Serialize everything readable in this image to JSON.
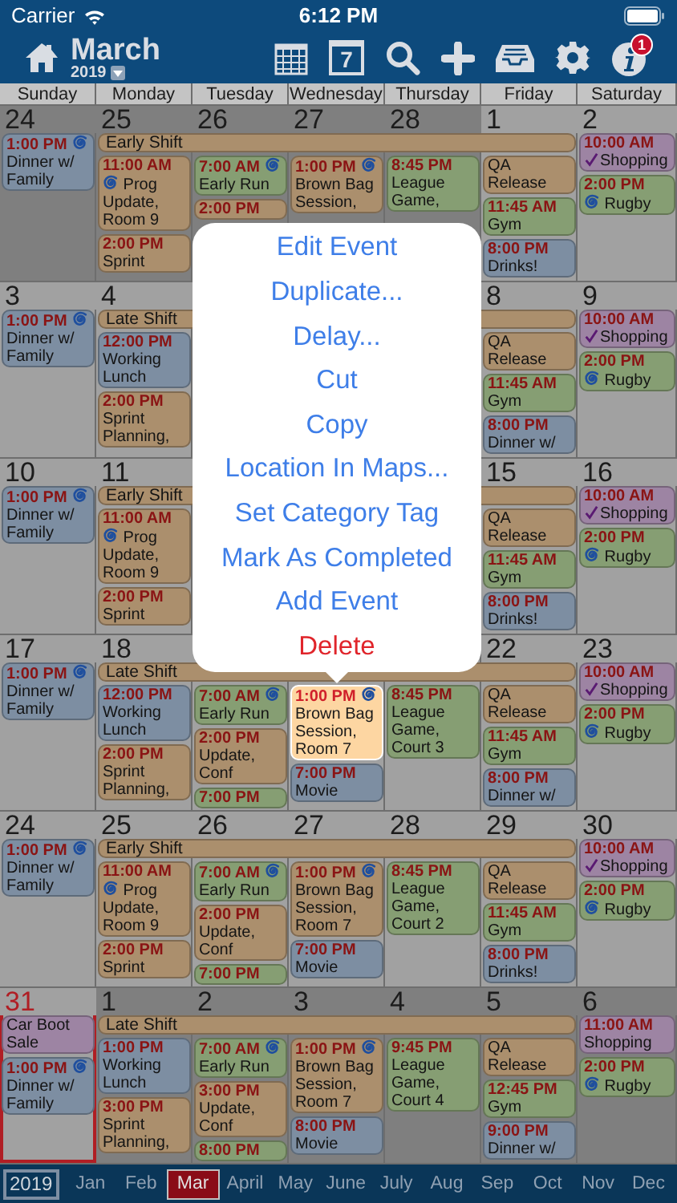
{
  "status_bar": {
    "carrier": "Carrier",
    "time": "6:12 PM"
  },
  "toolbar": {
    "month": "March",
    "year": "2019",
    "day_number": "7",
    "info_badge": "1"
  },
  "weekdays": [
    "Sunday",
    "Monday",
    "Tuesday",
    "Wednesday",
    "Thursday",
    "Friday",
    "Saturday"
  ],
  "weeks": [
    {
      "banner": {
        "title": "Early Shift",
        "color": "#ab8f6d"
      },
      "days": {
        "sunday": {
          "date": "24",
          "other_month": true,
          "today": false,
          "events": [
            {
              "kind": "timed",
              "time": "1:00 PM",
              "title": "Dinner w/ Family",
              "color": "#7d8ea2",
              "repeat_after_time": true,
              "selected": false
            }
          ]
        },
        "monday": {
          "date": "25",
          "other_month": true,
          "today": false,
          "events": [
            {
              "kind": "timed",
              "time": "11:00 AM",
              "title": "Prog Update, Room 9",
              "color": "#ab8f6d",
              "repeat_before_title": true,
              "selected": false
            },
            {
              "kind": "timed",
              "time": "2:00 PM",
              "title": "Sprint",
              "color": "#ab8f6d",
              "selected": false
            }
          ]
        },
        "tuesday": {
          "date": "26",
          "other_month": true,
          "today": false,
          "events": [
            {
              "kind": "timed",
              "time": "7:00 AM",
              "title": "Early Run",
              "color": "#869e73",
              "repeat_after_time": true,
              "selected": false
            },
            {
              "kind": "timed",
              "time": "2:00 PM",
              "color": "#ab8f6d",
              "selected": false
            }
          ]
        },
        "wednesday": {
          "date": "27",
          "other_month": true,
          "today": false,
          "events": [
            {
              "kind": "timed",
              "time": "1:00 PM",
              "title": "Brown Bag Session,",
              "color": "#ab8f6d",
              "repeat_after_time": true,
              "selected": false
            }
          ]
        },
        "thursday": {
          "date": "28",
          "other_month": true,
          "today": false,
          "events": [
            {
              "kind": "timed",
              "time": "8:45 PM",
              "title": "League Game,",
              "color": "#869e73",
              "selected": false
            }
          ]
        },
        "friday": {
          "date": "1",
          "other_month": false,
          "today": false,
          "events": [
            {
              "kind": "allday",
              "title": "QA Release",
              "color": "#ab8f6d",
              "selected": false
            },
            {
              "kind": "inline",
              "time": "11:45 AM",
              "title": "Gym",
              "color": "#869e73",
              "selected": false
            },
            {
              "kind": "timed",
              "time": "8:00 PM",
              "title": "Drinks!",
              "color": "#7d8ea2",
              "selected": false
            }
          ]
        },
        "saturday": {
          "date": "2",
          "other_month": false,
          "today": false,
          "events": [
            {
              "kind": "timed",
              "time": "10:00 AM",
              "title": "Shopping",
              "color": "#9d84a3",
              "done": true,
              "selected": false
            },
            {
              "kind": "timed",
              "time": "2:00 PM",
              "title": "Rugby",
              "color": "#869e73",
              "repeat_before_title": true,
              "selected": false
            }
          ]
        }
      }
    },
    {
      "banner": {
        "title": "Late Shift",
        "color": "#ab8f6d"
      },
      "days": {
        "sunday": {
          "date": "3",
          "other_month": false,
          "today": false,
          "events": [
            {
              "kind": "timed",
              "time": "1:00 PM",
              "title": "Dinner w/ Family",
              "color": "#7d8ea2",
              "repeat_after_time": true,
              "selected": false
            }
          ]
        },
        "monday": {
          "date": "4",
          "other_month": false,
          "today": false,
          "events": [
            {
              "kind": "timed",
              "time": "12:00 PM",
              "title": "Working Lunch",
              "color": "#7d8ea2",
              "selected": false
            },
            {
              "kind": "timed",
              "time": "2:00 PM",
              "title": "Sprint Planning,",
              "color": "#ab8f6d",
              "selected": false
            }
          ]
        },
        "friday": {
          "date": "8",
          "other_month": false,
          "today": false,
          "events": [
            {
              "kind": "allday",
              "title": "QA Release",
              "color": "#ab8f6d",
              "selected": false
            },
            {
              "kind": "inline",
              "time": "11:45 AM",
              "title": "Gym",
              "color": "#869e73",
              "selected": false
            },
            {
              "kind": "timed",
              "time": "8:00 PM",
              "title": "Dinner w/",
              "color": "#7d8ea2",
              "selected": false
            }
          ]
        },
        "saturday": {
          "date": "9",
          "other_month": false,
          "today": false,
          "events": [
            {
              "kind": "timed",
              "time": "10:00 AM",
              "title": "Shopping",
              "color": "#9d84a3",
              "done": true,
              "selected": false
            },
            {
              "kind": "timed",
              "time": "2:00 PM",
              "title": "Rugby",
              "color": "#869e73",
              "repeat_before_title": true,
              "selected": false
            }
          ]
        }
      }
    },
    {
      "banner": {
        "title": "Early Shift",
        "color": "#ab8f6d"
      },
      "days": {
        "sunday": {
          "date": "10",
          "other_month": false,
          "today": false,
          "events": [
            {
              "kind": "timed",
              "time": "1:00 PM",
              "title": "Dinner w/ Family",
              "color": "#7d8ea2",
              "repeat_after_time": true,
              "selected": false
            }
          ]
        },
        "monday": {
          "date": "11",
          "other_month": false,
          "today": false,
          "events": [
            {
              "kind": "timed",
              "time": "11:00 AM",
              "title": "Prog Update, Room 9",
              "color": "#ab8f6d",
              "repeat_before_title": true,
              "selected": false
            },
            {
              "kind": "timed",
              "time": "2:00 PM",
              "title": "Sprint",
              "color": "#ab8f6d",
              "selected": false
            }
          ]
        },
        "friday": {
          "date": "15",
          "other_month": false,
          "today": false,
          "events": [
            {
              "kind": "allday",
              "title": "QA Release",
              "color": "#ab8f6d",
              "selected": false
            },
            {
              "kind": "inline",
              "time": "11:45 AM",
              "title": "Gym",
              "color": "#869e73",
              "selected": false
            },
            {
              "kind": "timed",
              "time": "8:00 PM",
              "title": "Drinks!",
              "color": "#7d8ea2",
              "selected": false
            }
          ]
        },
        "saturday": {
          "date": "16",
          "other_month": false,
          "today": false,
          "events": [
            {
              "kind": "timed",
              "time": "10:00 AM",
              "title": "Shopping",
              "color": "#9d84a3",
              "done": true,
              "selected": false
            },
            {
              "kind": "timed",
              "time": "2:00 PM",
              "title": "Rugby",
              "color": "#869e73",
              "repeat_before_title": true,
              "selected": false
            }
          ]
        }
      }
    },
    {
      "banner": {
        "title": "Late Shift",
        "color": "#ab8f6d"
      },
      "days": {
        "sunday": {
          "date": "17",
          "other_month": false,
          "today": false,
          "events": [
            {
              "kind": "timed",
              "time": "1:00 PM",
              "title": "Dinner w/ Family",
              "color": "#7d8ea2",
              "repeat_after_time": true,
              "selected": false
            }
          ]
        },
        "monday": {
          "date": "18",
          "other_month": false,
          "today": false,
          "events": [
            {
              "kind": "timed",
              "time": "12:00 PM",
              "title": "Working Lunch",
              "color": "#7d8ea2",
              "selected": false
            },
            {
              "kind": "timed",
              "time": "2:00 PM",
              "title": "Sprint Planning,",
              "color": "#ab8f6d",
              "selected": false
            }
          ]
        },
        "tuesday": {
          "events": [
            {
              "kind": "timed",
              "time": "7:00 AM",
              "title": "Early Run",
              "color": "#869e73",
              "repeat_after_time": true,
              "selected": false
            },
            {
              "kind": "timed",
              "time": "2:00 PM",
              "title": "Update, Conf",
              "color": "#ab8f6d",
              "selected": false
            },
            {
              "kind": "timed",
              "time": "7:00 PM",
              "color": "#869e73",
              "selected": false
            }
          ]
        },
        "wednesday": {
          "events": [
            {
              "kind": "timed",
              "time": "1:00 PM",
              "title": "Brown Bag Session, Room 7",
              "color": "#fdd6a2",
              "repeat_after_time": true,
              "selected": true
            },
            {
              "kind": "timed",
              "time": "7:00 PM",
              "title": "Movie",
              "color": "#7d8ea2",
              "selected": false
            }
          ]
        },
        "thursday": {
          "events": [
            {
              "kind": "timed",
              "time": "8:45 PM",
              "title": "League Game, Court 3",
              "color": "#869e73",
              "selected": false
            }
          ]
        },
        "friday": {
          "date": "22",
          "other_month": false,
          "today": false,
          "events": [
            {
              "kind": "allday",
              "title": "QA Release",
              "color": "#ab8f6d",
              "selected": false
            },
            {
              "kind": "inline",
              "time": "11:45 AM",
              "title": "Gym",
              "color": "#869e73",
              "selected": false
            },
            {
              "kind": "timed",
              "time": "8:00 PM",
              "title": "Dinner w/",
              "color": "#7d8ea2",
              "selected": false
            }
          ]
        },
        "saturday": {
          "date": "23",
          "other_month": false,
          "today": false,
          "events": [
            {
              "kind": "timed",
              "time": "10:00 AM",
              "title": "Shopping",
              "color": "#9d84a3",
              "done": true,
              "selected": false
            },
            {
              "kind": "timed",
              "time": "2:00 PM",
              "title": "Rugby",
              "color": "#869e73",
              "repeat_before_title": true,
              "selected": false
            }
          ]
        }
      }
    },
    {
      "banner": {
        "title": "Early Shift",
        "color": "#ab8f6d"
      },
      "days": {
        "sunday": {
          "date": "24",
          "other_month": false,
          "today": false,
          "events": [
            {
              "kind": "timed",
              "time": "1:00 PM",
              "title": "Dinner w/ Family",
              "color": "#7d8ea2",
              "repeat_after_time": true,
              "selected": false
            }
          ]
        },
        "monday": {
          "date": "25",
          "other_month": false,
          "today": false,
          "events": [
            {
              "kind": "timed",
              "time": "11:00 AM",
              "title": "Prog Update, Room 9",
              "color": "#ab8f6d",
              "repeat_before_title": true,
              "selected": false
            },
            {
              "kind": "timed",
              "time": "2:00 PM",
              "title": "Sprint",
              "color": "#ab8f6d",
              "selected": false
            }
          ]
        },
        "tuesday": {
          "date": "26",
          "other_month": false,
          "today": false,
          "events": [
            {
              "kind": "timed",
              "time": "7:00 AM",
              "title": "Early Run",
              "color": "#869e73",
              "repeat_after_time": true,
              "selected": false
            },
            {
              "kind": "timed",
              "time": "2:00 PM",
              "title": "Update, Conf",
              "color": "#ab8f6d",
              "selected": false
            },
            {
              "kind": "timed",
              "time": "7:00 PM",
              "color": "#869e73",
              "selected": false
            }
          ]
        },
        "wednesday": {
          "date": "27",
          "other_month": false,
          "today": false,
          "events": [
            {
              "kind": "timed",
              "time": "1:00 PM",
              "title": "Brown Bag Session, Room 7",
              "color": "#ab8f6d",
              "repeat_after_time": true,
              "selected": false
            },
            {
              "kind": "timed",
              "time": "7:00 PM",
              "title": "Movie",
              "color": "#7d8ea2",
              "selected": false
            }
          ]
        },
        "thursday": {
          "date": "28",
          "other_month": false,
          "today": false,
          "events": [
            {
              "kind": "timed",
              "time": "8:45 PM",
              "title": "League Game, Court 2",
              "color": "#869e73",
              "selected": false
            }
          ]
        },
        "friday": {
          "date": "29",
          "other_month": false,
          "today": false,
          "events": [
            {
              "kind": "allday",
              "title": "QA Release",
              "color": "#ab8f6d",
              "selected": false
            },
            {
              "kind": "inline",
              "time": "11:45 AM",
              "title": "Gym",
              "color": "#869e73",
              "selected": false
            },
            {
              "kind": "timed",
              "time": "8:00 PM",
              "title": "Drinks!",
              "color": "#7d8ea2",
              "selected": false
            }
          ]
        },
        "saturday": {
          "date": "30",
          "other_month": false,
          "today": false,
          "events": [
            {
              "kind": "timed",
              "time": "10:00 AM",
              "title": "Shopping",
              "color": "#9d84a3",
              "done": true,
              "selected": false
            },
            {
              "kind": "timed",
              "time": "2:00 PM",
              "title": "Rugby",
              "color": "#869e73",
              "repeat_before_title": true,
              "selected": false
            }
          ]
        }
      }
    },
    {
      "banner": {
        "title": "Late Shift",
        "color": "#ab8f6d"
      },
      "days": {
        "sunday": {
          "date": "31",
          "other_month": false,
          "today": true,
          "events": [
            {
              "kind": "allday",
              "title": "Car Boot Sale",
              "color": "#9d84a3",
              "selected": false
            },
            {
              "kind": "timed",
              "time": "1:00 PM",
              "title": "Dinner w/ Family",
              "color": "#7d8ea2",
              "repeat_after_time": true,
              "selected": false
            }
          ]
        },
        "monday": {
          "date": "1",
          "other_month": true,
          "today": false,
          "events": [
            {
              "kind": "timed",
              "time": "1:00 PM",
              "title": "Working Lunch",
              "color": "#7d8ea2",
              "selected": false
            },
            {
              "kind": "timed",
              "time": "3:00 PM",
              "title": "Sprint Planning,",
              "color": "#ab8f6d",
              "selected": false
            }
          ]
        },
        "tuesday": {
          "date": "2",
          "other_month": true,
          "today": false,
          "events": [
            {
              "kind": "timed",
              "time": "7:00 AM",
              "title": "Early Run",
              "color": "#869e73",
              "repeat_after_time": true,
              "selected": false
            },
            {
              "kind": "timed",
              "time": "3:00 PM",
              "title": "Update, Conf",
              "color": "#ab8f6d",
              "selected": false
            },
            {
              "kind": "timed",
              "time": "8:00 PM",
              "color": "#869e73",
              "selected": false
            }
          ]
        },
        "wednesday": {
          "date": "3",
          "other_month": true,
          "today": false,
          "events": [
            {
              "kind": "timed",
              "time": "1:00 PM",
              "title": "Brown Bag Session, Room 7",
              "color": "#ab8f6d",
              "repeat_after_time": true,
              "selected": false
            },
            {
              "kind": "timed",
              "time": "8:00 PM",
              "title": "Movie",
              "color": "#7d8ea2",
              "selected": false
            }
          ]
        },
        "thursday": {
          "date": "4",
          "other_month": true,
          "today": false,
          "events": [
            {
              "kind": "timed",
              "time": "9:45 PM",
              "title": "League Game, Court 4",
              "color": "#869e73",
              "selected": false
            }
          ]
        },
        "friday": {
          "date": "5",
          "other_month": true,
          "today": false,
          "events": [
            {
              "kind": "allday",
              "title": "QA Release",
              "color": "#ab8f6d",
              "selected": false
            },
            {
              "kind": "inline",
              "time": "12:45 PM",
              "title": "Gym",
              "color": "#869e73",
              "selected": false
            },
            {
              "kind": "timed",
              "time": "9:00 PM",
              "title": "Dinner w/",
              "color": "#7d8ea2",
              "selected": false
            }
          ]
        },
        "saturday": {
          "date": "6",
          "other_month": true,
          "today": false,
          "events": [
            {
              "kind": "timed",
              "time": "11:00 AM",
              "title": "Shopping",
              "color": "#9d84a3",
              "selected": false
            },
            {
              "kind": "timed",
              "time": "2:00 PM",
              "title": "Rugby",
              "color": "#869e73",
              "repeat_before_title": true,
              "selected": false
            }
          ]
        }
      }
    }
  ],
  "context_menu": [
    {
      "label": "Edit Event",
      "destructive": false
    },
    {
      "label": "Duplicate...",
      "destructive": false
    },
    {
      "label": "Delay...",
      "destructive": false
    },
    {
      "label": "Cut",
      "destructive": false
    },
    {
      "label": "Copy",
      "destructive": false
    },
    {
      "label": "Location In Maps...",
      "destructive": false
    },
    {
      "label": "Set Category Tag",
      "destructive": false
    },
    {
      "label": "Mark As Completed",
      "destructive": false
    },
    {
      "label": "Add Event",
      "destructive": false
    },
    {
      "label": "Delete",
      "destructive": true
    }
  ],
  "month_bar": {
    "year": "2019",
    "months": [
      {
        "label": "Jan",
        "selected": false
      },
      {
        "label": "Feb",
        "selected": false
      },
      {
        "label": "Mar",
        "selected": true
      },
      {
        "label": "April",
        "selected": false
      },
      {
        "label": "May",
        "selected": false
      },
      {
        "label": "June",
        "selected": false
      },
      {
        "label": "July",
        "selected": false
      },
      {
        "label": "Aug",
        "selected": false
      },
      {
        "label": "Sep",
        "selected": false
      },
      {
        "label": "Oct",
        "selected": false
      },
      {
        "label": "Nov",
        "selected": false
      },
      {
        "label": "Dec",
        "selected": false
      }
    ]
  }
}
